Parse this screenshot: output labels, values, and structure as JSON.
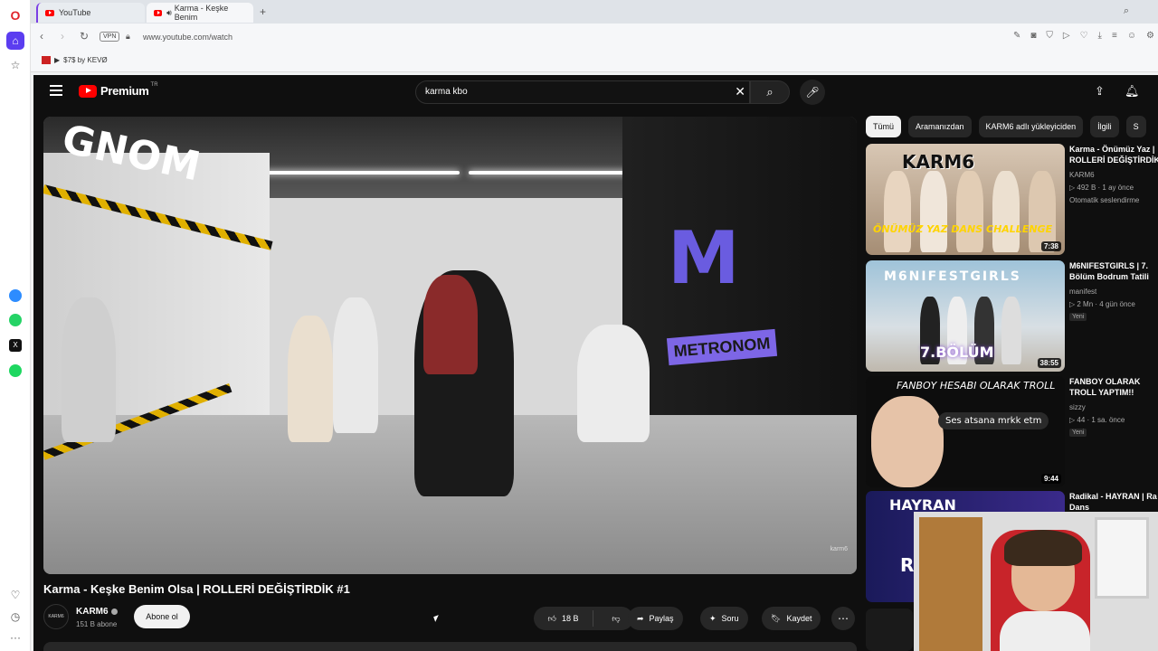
{
  "browser": {
    "tabs": [
      {
        "title": "YouTube"
      },
      {
        "title": "Karma - Keşke Benim"
      }
    ],
    "new_tab": "+",
    "url": "www.youtube.com/watch",
    "vpn_label": "VPN",
    "bookmark": "$7$ by KEVØ"
  },
  "youtube": {
    "logo": "Premium",
    "region": "TR",
    "search_value": "karma kbo"
  },
  "video": {
    "title": "Karma - Keşke Benim Olsa | ROLLERİ DEĞİŞTİRDİK #1",
    "channel": "KARM6",
    "subscribers": "151 B abone",
    "subscribe_label": "Abone ol",
    "likes": "18 B",
    "share_label": "Paylaş",
    "ask_label": "Soru",
    "save_label": "Kaydet",
    "thumb_watermark": "karm6",
    "scene_text_gnom": "GNOM",
    "scene_text_m": "M",
    "scene_text_metronom": "METRONOM"
  },
  "chips": [
    "Tümü",
    "Aramanızdan",
    "KARM6 adlı yükleyiciden",
    "İlgili",
    "S"
  ],
  "recommendations": [
    {
      "title": "Karma - Önümüz Yaz | ROLLERİ DEĞİŞTİRDİK",
      "channel": "KARM6",
      "meta": "▷ 492 B · 1 ay önce",
      "badge": "Otomatik seslendirme",
      "duration": "7:38",
      "thumb_text": "ÖNÜMÜZ YAZ DANS CHALLENGE",
      "thumb_logo": "KARM6"
    },
    {
      "title": "M6NIFESTGIRLS | 7. Bölüm Bodrum Tatili",
      "channel": "manifest",
      "meta": "▷ 2 Mn · 4 gün önce",
      "badge": "Yeni",
      "duration": "38:55",
      "thumb_text": "7.BÖLÜM",
      "thumb_logo": "M6NIFESTGIRLS"
    },
    {
      "title": "FANBOY OLARAK TROLL YAPTIM!!",
      "channel": "sizzy",
      "meta": "▷ 44 · 1 sa. önce",
      "badge": "Yeni",
      "duration": "9:44",
      "thumb_text": "FANBOY HESABI OLARAK TROLL",
      "thumb_bubble": "Ses atsana mrkk etm"
    },
    {
      "title": "Radikal - HAYRAN | Ra Dans",
      "thumb_text": "HAYRAN",
      "thumb_letter": "R"
    }
  ],
  "colors": {
    "yt_bg": "#0f0f0f",
    "yt_red": "#ff0000",
    "opera_red": "#e0242c",
    "opera_purple": "#5b3df0"
  },
  "icons": {
    "hamburger": "menu-icon",
    "search": "search-icon",
    "mic": "mic-icon",
    "upload": "upload-icon",
    "bell": "bell-icon"
  }
}
